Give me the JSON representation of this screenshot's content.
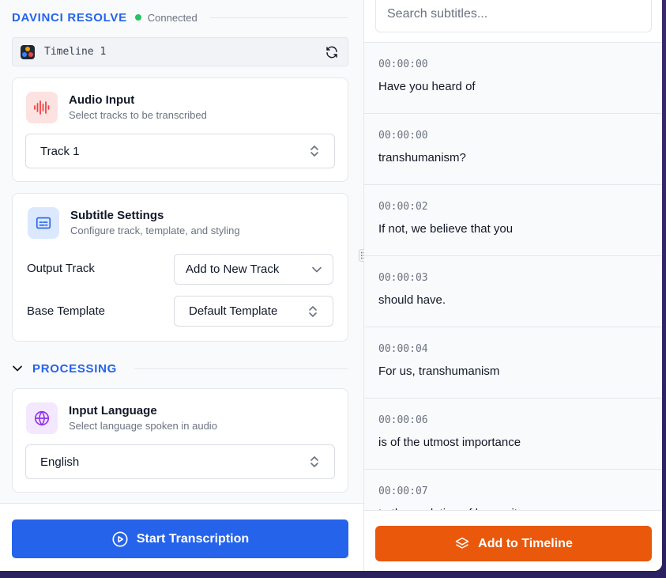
{
  "header": {
    "app_name": "DAVINCI RESOLVE",
    "status": "Connected",
    "status_color": "#22c55e"
  },
  "timeline": {
    "name": "Timeline 1"
  },
  "audio_input": {
    "title": "Audio Input",
    "subtitle": "Select tracks to be transcribed",
    "track_value": "Track 1",
    "icon": "waveform-icon"
  },
  "subtitle_settings": {
    "title": "Subtitle Settings",
    "subtitle": "Configure track, template, and styling",
    "output_track_label": "Output Track",
    "output_track_value": "Add to New Track",
    "base_template_label": "Base Template",
    "base_template_value": "Default Template",
    "icon": "subtitles-icon"
  },
  "processing": {
    "section_title": "PROCESSING"
  },
  "input_language": {
    "title": "Input Language",
    "subtitle": "Select language spoken in audio",
    "value": "English",
    "icon": "globe-icon"
  },
  "actions": {
    "start_label": "Start Transcription",
    "add_label": "Add to Timeline"
  },
  "search": {
    "placeholder": "Search subtitles..."
  },
  "subtitles": [
    {
      "time": "00:00:00",
      "text": "Have you heard of"
    },
    {
      "time": "00:00:00",
      "text": "transhumanism?"
    },
    {
      "time": "00:00:02",
      "text": "If not, we believe that you"
    },
    {
      "time": "00:00:03",
      "text": "should have."
    },
    {
      "time": "00:00:04",
      "text": "For us, transhumanism"
    },
    {
      "time": "00:00:06",
      "text": "is of the utmost importance"
    },
    {
      "time": "00:00:07",
      "text": "to the evolution of humanity"
    }
  ],
  "colors": {
    "accent_blue": "#2563eb",
    "accent_orange": "#ea580c"
  }
}
